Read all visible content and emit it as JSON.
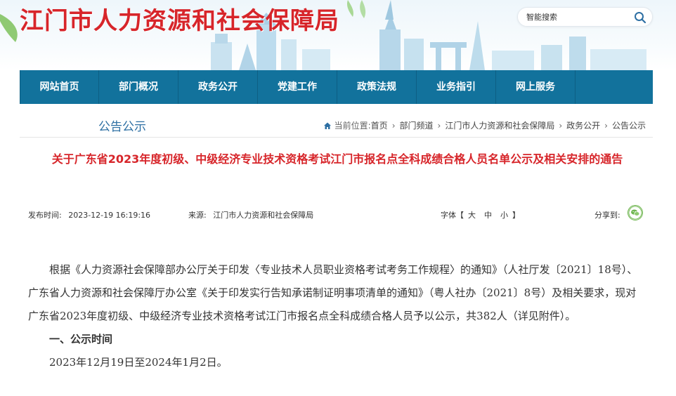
{
  "header": {
    "site_title": "江门市人力资源和社会保障局",
    "search_placeholder": "智能搜索",
    "search_icon": "search-icon"
  },
  "nav": {
    "items": [
      "网站首页",
      "部门概况",
      "政务公开",
      "党建工作",
      "政策法规",
      "业务指引",
      "网上服务"
    ]
  },
  "location": {
    "section_title": "公告公示",
    "prefix": "当前位置:",
    "crumbs": [
      "首页",
      "部门频道",
      "江门市人力资源和社会保障局",
      "政务公开",
      "公告公示"
    ],
    "home_icon": "home-icon"
  },
  "article": {
    "title": "关于广东省2023年度初级、中级经济专业技术资格考试江门市报名点全科成绩合格人员名单公示及相关安排的通告",
    "publish_label": "发布时间:",
    "publish_time": "2023-12-19 16:19:16",
    "source_label": "来源:",
    "source": "江门市人力资源和社会保障局",
    "font_label": "字体【",
    "font_sizes": [
      "大",
      "中",
      "小"
    ],
    "font_close": "】",
    "share_label": "分享到:",
    "share_icon": "wechat-icon",
    "paragraph1": "根据《人力资源社会保障部办公厅关于印发〈专业技术人员职业资格考试考务工作规程〉的通知》（人社厅发〔2021〕18号）、广东省人力资源和社会保障厅办公室《关于印发实行告知承诺制证明事项清单的通知》（粤人社办〔2021〕8号）及相关要求，现对广东省2023年度初级、中级经济专业技术资格考试江门市报名点全科成绩合格人员予以公示，共382人（详见附件）。",
    "heading1": "一、公示时间",
    "paragraph2": "2023年12月19日至2024年1月2日。"
  },
  "colors": {
    "title_red": "#d7252a",
    "nav_blue": "#12729c",
    "section_blue": "#2d6fa3",
    "wechat_green": "#6ab34a"
  }
}
